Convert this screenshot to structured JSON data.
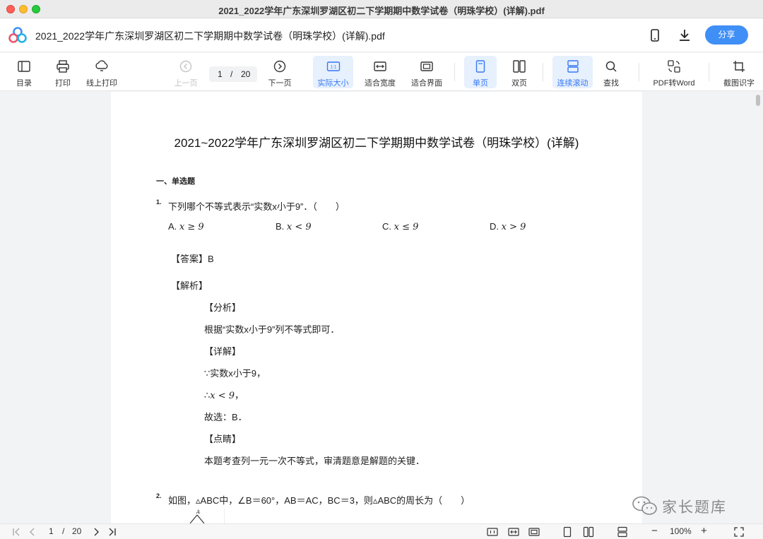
{
  "window": {
    "title": "2021_2022学年广东深圳罗湖区初二下学期期中数学试卷（明珠学校）(详解).pdf"
  },
  "appbar": {
    "doc_title": "2021_2022学年广东深圳罗湖区初二下学期期中数学试卷（明珠学校）(详解).pdf",
    "share_label": "分享"
  },
  "toolbar": {
    "toc": "目录",
    "print": "打印",
    "online_print": "线上打印",
    "prev_page": "上一页",
    "next_page": "下一页",
    "page_current": "1",
    "page_sep": "/",
    "page_total": "20",
    "actual_size": "实际大小",
    "fit_width": "适合宽度",
    "fit_page": "适合界面",
    "single_page": "单页",
    "double_page": "双页",
    "continuous": "连续滚动",
    "search": "查找",
    "pdf_to_word": "PDF转Word",
    "screenshot_ocr": "截图识字",
    "actual_size_badge": "1:1"
  },
  "document": {
    "title": "2021~2022学年广东深圳罗湖区初二下学期期中数学试卷（明珠学校）(详解)",
    "section": "一、单选题",
    "q1": {
      "number": "1.",
      "stem": "下列哪个不等式表示“实数x小于9”．（　　）",
      "options": [
        {
          "letter": "A.",
          "math": "x ≥ 9"
        },
        {
          "letter": "B.",
          "math": "x < 9"
        },
        {
          "letter": "C.",
          "math": "x ≤ 9"
        },
        {
          "letter": "D.",
          "math": "x > 9"
        }
      ],
      "answer": "【答案】B",
      "analysis_head": "【解析】",
      "fenxi_head": "【分析】",
      "fenxi": "根据“实数x小于9”列不等式即可．",
      "xiangjie_head": "【详解】",
      "line1": "∵实数x小于9，",
      "line2_prefix": "∴",
      "line2_math": "x < 9",
      "line2_suffix": "，",
      "line3": "故选：B．",
      "dianjing_head": "【点睛】",
      "dianjing": "本题考查列一元一次不等式，审清题意是解题的关键．"
    },
    "q2": {
      "number": "2.",
      "stem": "如图，▵ABC中，∠B＝60°，AB＝AC，BC＝3，则▵ABC的周长为（　　）",
      "figure_label": "A"
    }
  },
  "statusbar": {
    "page_current": "1",
    "page_sep": "/",
    "page_total": "20",
    "zoom": "100%",
    "zoom_out": "−",
    "zoom_in": "+"
  },
  "watermark": {
    "text": "家长题库"
  },
  "colors": {
    "accent": "#3f8ff7",
    "active_bg": "#e7f0fd",
    "active_text": "#3579f6"
  }
}
